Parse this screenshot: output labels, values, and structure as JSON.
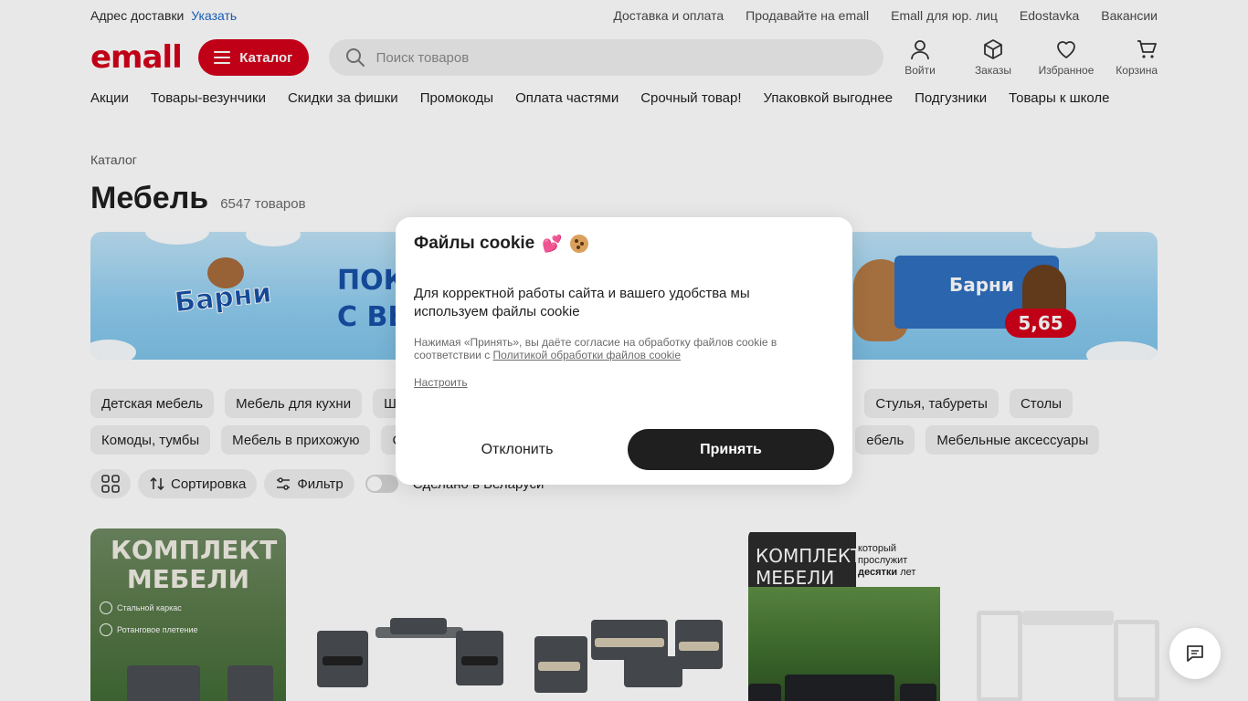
{
  "topbar": {
    "address_label": "Адрес доставки",
    "address_link": "Указать",
    "links": [
      "Доставка и оплата",
      "Продавайте на emall",
      "Emall для юр. лиц",
      "Edostavka",
      "Вакансии"
    ]
  },
  "header": {
    "logo": "emall",
    "catalog_label": "Каталог",
    "search_placeholder": "Поиск товаров",
    "icons": [
      {
        "label": "Войти",
        "icon": "user-icon"
      },
      {
        "label": "Заказы",
        "icon": "box-icon"
      },
      {
        "label": "Избранное",
        "icon": "heart-icon"
      },
      {
        "label": "Корзина",
        "icon": "cart-icon"
      }
    ],
    "brand_color": "#d4001a"
  },
  "nav": [
    "Акции",
    "Товары-везунчики",
    "Скидки за фишки",
    "Промокоды",
    "Оплата частями",
    "Срочный товар!",
    "Упаковкой выгоднее",
    "Подгузники",
    "Товары к школе"
  ],
  "breadcrumb": "Каталог",
  "page": {
    "title": "Мебель",
    "count": "6547 товаров"
  },
  "banner": {
    "brand": "Барни",
    "text_line1": "ПОКУ",
    "text_line2": "С ВЫ",
    "product_label": "Барни",
    "price": "5,65"
  },
  "chips_row1": [
    "Детская мебель",
    "Мебель для кухни",
    "Шк",
    "Стулья, табуреты",
    "Столы"
  ],
  "chips_row2": [
    "Комоды, тумбы",
    "Мебель в прихожую",
    "С",
    "ебель",
    "Мебельные аксессуары"
  ],
  "tools": {
    "sort": "Сортировка",
    "filter": "Фильтр",
    "made_in": "Сделано в Беларуси"
  },
  "products": [
    {
      "kind": "kit",
      "title": "КОМПЛЕКТ МЕБЕЛИ",
      "badges": [
        "Стальной каркас",
        "Ротанговое плетение"
      ]
    },
    {
      "kind": "set"
    },
    {
      "kind": "set2"
    },
    {
      "kind": "kit2",
      "title": "КОМПЛЕКТ МЕБЕЛИ",
      "sub_line1": "который",
      "sub_line2": "прослужит",
      "sub_bold": "десятки",
      "sub_end": "лет"
    },
    {
      "kind": "white"
    }
  ],
  "cookie_dialog": {
    "title": "Файлы cookie",
    "text": "Для корректной работы сайта и вашего удобства мы используем файлы cookie",
    "small_text": "Нажимая «Принять», вы даёте согласие на обработку файлов cookie в соответствии с",
    "policy_link": "Политикой обработки файлов cookie",
    "settings_link": "Настроить",
    "decline": "Отклонить",
    "accept": "Принять"
  }
}
